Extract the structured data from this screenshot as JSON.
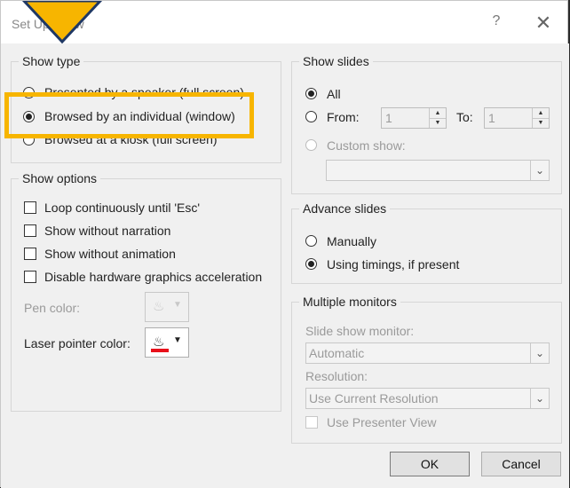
{
  "dialog": {
    "title": "Set Up Show",
    "help_label": "?",
    "close_label": "✕"
  },
  "show_type": {
    "label": "Show type",
    "options": [
      {
        "label": "Presented by a speaker (full screen)",
        "selected": false
      },
      {
        "label": "Browsed by an individual (window)",
        "selected": true
      },
      {
        "label": "Browsed at a kiosk (full screen)",
        "selected": false
      }
    ]
  },
  "show_options": {
    "label": "Show options",
    "items": [
      {
        "label": "Loop continuously until 'Esc'",
        "checked": false
      },
      {
        "label": "Show without narration",
        "checked": false
      },
      {
        "label": "Show without animation",
        "checked": false
      },
      {
        "label": "Disable hardware graphics acceleration",
        "checked": false
      }
    ],
    "pen_color_label": "Pen color:",
    "laser_color_label": "Laser pointer color:",
    "laser_color": "#e8101a",
    "pen_icon": "paint-bucket-icon",
    "laser_icon": "paint-bucket-icon"
  },
  "show_slides": {
    "label": "Show slides",
    "all_label": "All",
    "from_label": "From:",
    "from_value": "1",
    "to_label": "To:",
    "to_value": "1",
    "custom_label": "Custom show:",
    "custom_value": ""
  },
  "advance_slides": {
    "label": "Advance slides",
    "manually_label": "Manually",
    "timings_label": "Using timings, if present",
    "selected": "timings"
  },
  "monitors": {
    "label": "Multiple monitors",
    "monitor_label": "Slide show monitor:",
    "monitor_value": "Automatic",
    "resolution_label": "Resolution:",
    "resolution_value": "Use Current Resolution",
    "presenter_view_label": "Use Presenter View",
    "presenter_view_checked": false
  },
  "buttons": {
    "ok": "OK",
    "cancel": "Cancel"
  },
  "colors": {
    "highlight": "#f7b500",
    "pointer": "#f7b500",
    "pointer_outline": "#1f3864"
  }
}
